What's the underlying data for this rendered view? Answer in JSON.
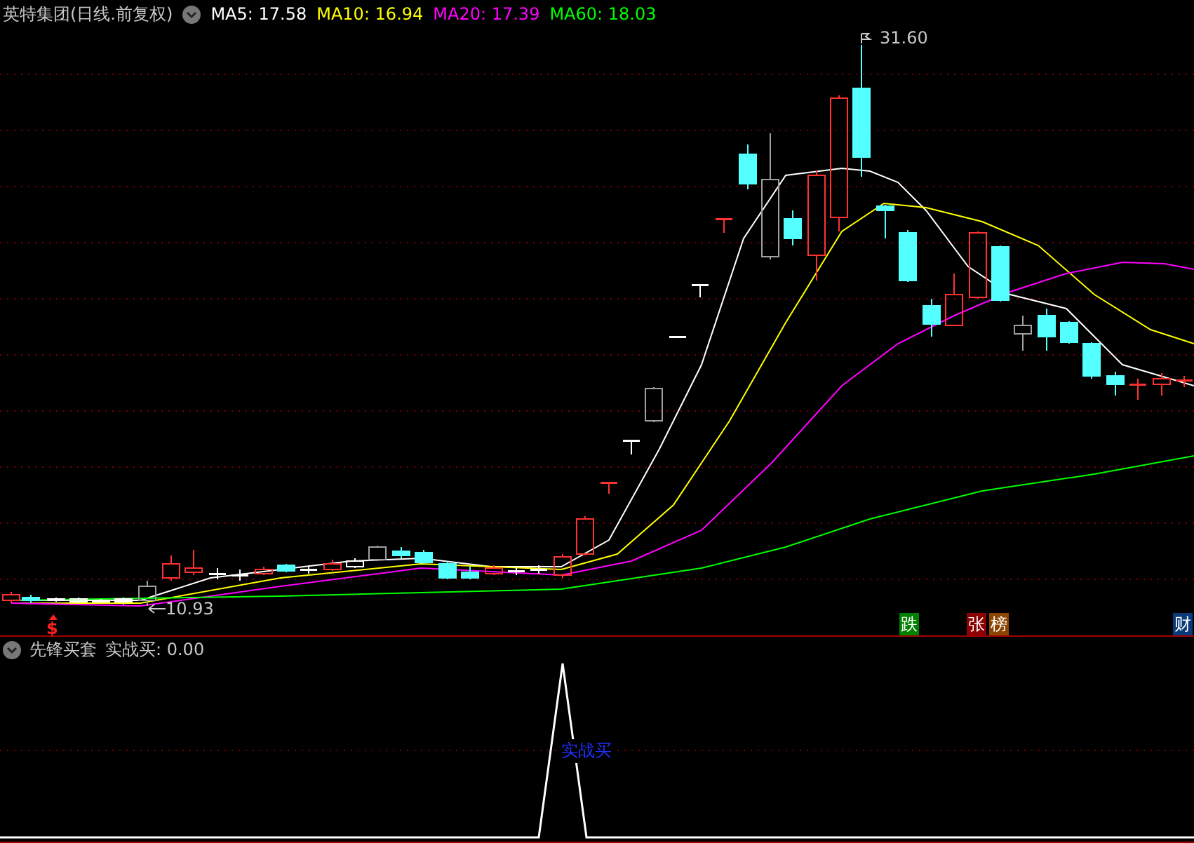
{
  "header": {
    "title": "英特集团(日线.前复权)",
    "indicators": [
      {
        "label": "MA5: 17.58",
        "color": "#ffffff"
      },
      {
        "label": "MA10: 16.94",
        "color": "#ffff00"
      },
      {
        "label": "MA20: 17.39",
        "color": "#ff00ff"
      },
      {
        "label": "MA60: 18.03",
        "color": "#00ff00"
      }
    ]
  },
  "price_chart": {
    "high_label": "31.60",
    "low_label": "10.93",
    "signal": "$",
    "badges": [
      {
        "text": "跌",
        "color": "#008000"
      },
      {
        "text": "张",
        "color": "#8b0000"
      },
      {
        "text": "榜",
        "color": "#8b4500"
      },
      {
        "text": "财",
        "color": "#0a3a7a"
      }
    ]
  },
  "sub_panel": {
    "title": "先锋买套",
    "reading": "实战买: 0.00",
    "signal_label": "实战买"
  }
}
